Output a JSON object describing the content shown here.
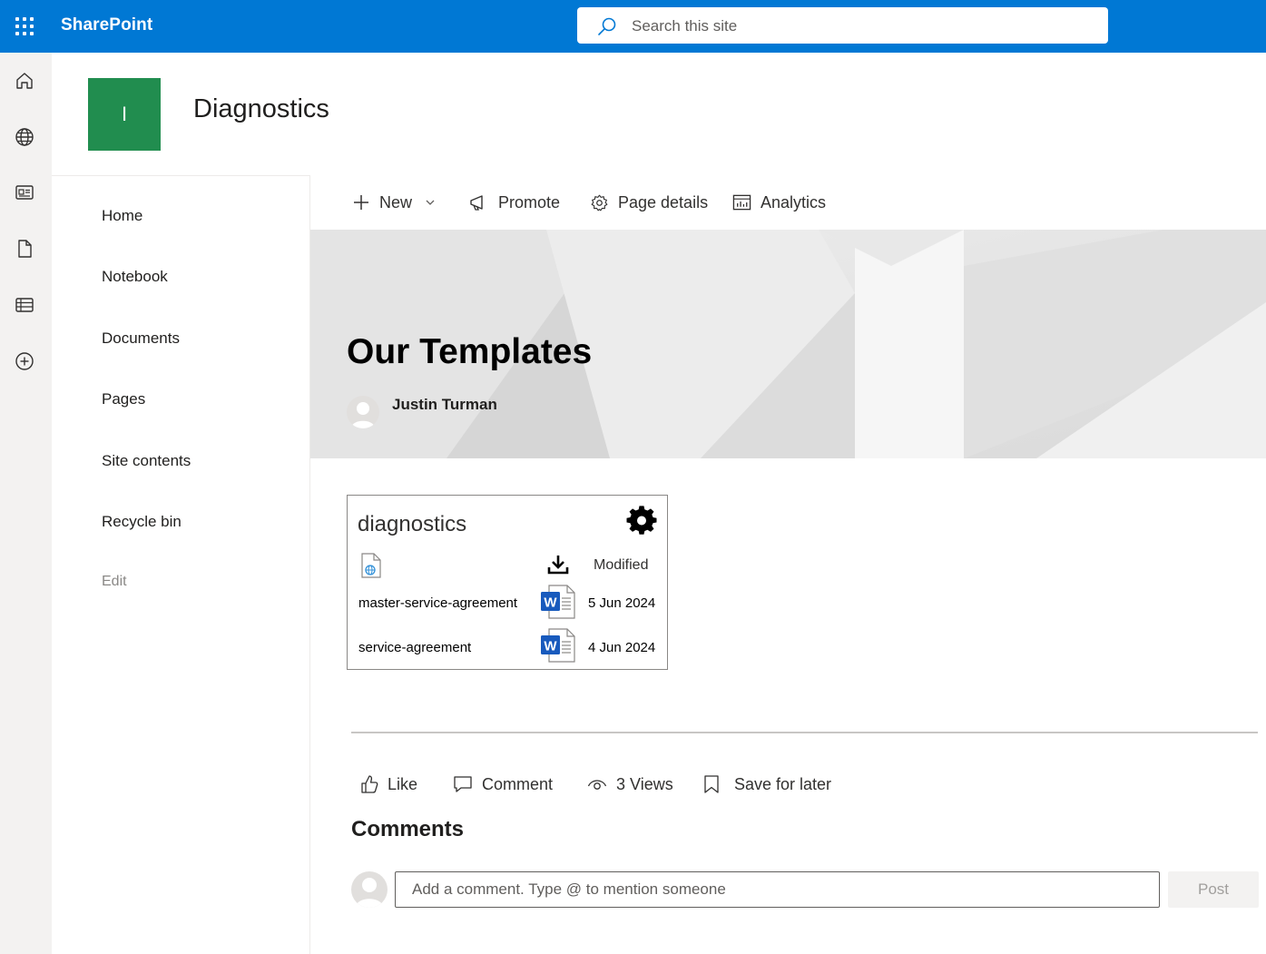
{
  "suite": {
    "brand": "SharePoint",
    "search_placeholder": "Search this site",
    "accent": "#0078d4"
  },
  "appbar": {
    "icons": [
      "home-icon",
      "globe-icon",
      "news-icon",
      "file-icon",
      "list-icon",
      "add-icon"
    ]
  },
  "site": {
    "logo_letter": "I",
    "logo_color": "#218d4f",
    "title": "Diagnostics"
  },
  "nav": {
    "items": [
      "Home",
      "Notebook",
      "Documents",
      "Pages",
      "Site contents",
      "Recycle bin"
    ],
    "edit_label": "Edit"
  },
  "commandbar": {
    "new_label": "New",
    "promote_label": "Promote",
    "page_details_label": "Page details",
    "analytics_label": "Analytics"
  },
  "page": {
    "title": "Our Templates",
    "author": "Justin Turman"
  },
  "webpart": {
    "title": "diagnostics",
    "modified_header": "Modified",
    "rows": [
      {
        "name": "master-service-agreement",
        "date": "5 Jun 2024",
        "file_icon": "word-icon"
      },
      {
        "name": "service-agreement",
        "date": "4 Jun 2024",
        "file_icon": "word-icon"
      }
    ]
  },
  "social": {
    "like_label": "Like",
    "comment_label": "Comment",
    "views_label": "3 Views",
    "save_label": "Save for later"
  },
  "comments": {
    "heading": "Comments",
    "placeholder": "Add a comment. Type @ to mention someone",
    "post_label": "Post"
  }
}
